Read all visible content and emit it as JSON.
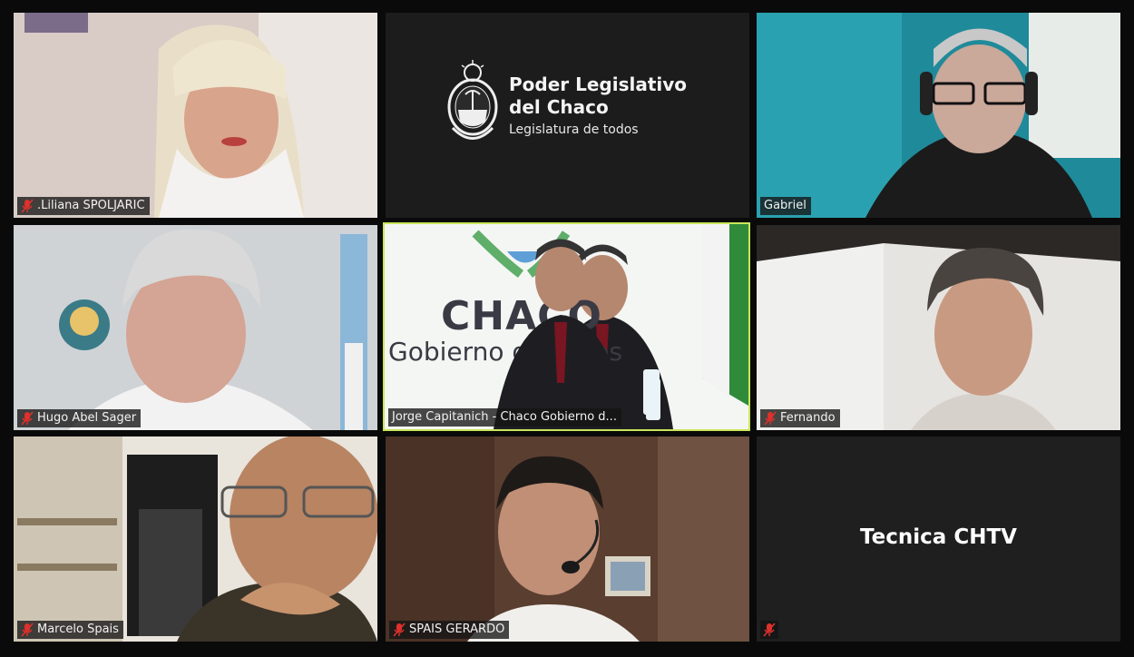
{
  "participants": [
    {
      "name": ".Liliana SPOLJARIC",
      "muted": true
    },
    {
      "name": "",
      "logo": {
        "line1": "Poder Legislativo",
        "line2": "del Chaco",
        "line3": "Legislatura de todos"
      }
    },
    {
      "name": "Gabriel",
      "muted": false
    },
    {
      "name": "Hugo Abel Sager",
      "muted": true
    },
    {
      "name": "Jorge Capitanich - Chaco Gobierno d...",
      "muted": false,
      "active_speaker": true,
      "background_text": {
        "brand": "CHACO",
        "sub": "Gobierno de todos"
      }
    },
    {
      "name": "Fernando",
      "muted": true
    },
    {
      "name": "Marcelo Spais",
      "muted": true
    },
    {
      "name": "SPAIS GERARDO",
      "muted": true
    },
    {
      "name": "",
      "muted": true,
      "display_text": "Tecnica CHTV"
    }
  ],
  "colors": {
    "active_border": "#c9e65a",
    "mute_icon": "#e0302b"
  }
}
